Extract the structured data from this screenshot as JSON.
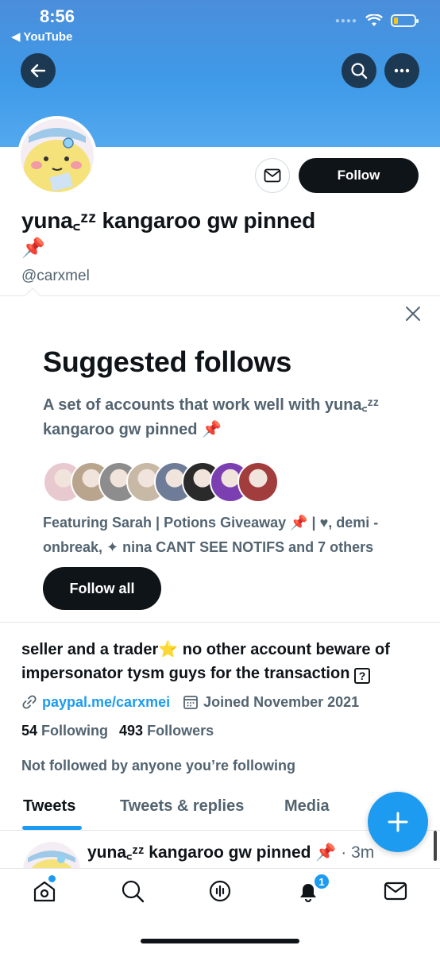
{
  "status_bar": {
    "time": "8:56",
    "back_app": "◀ YouTube"
  },
  "profile": {
    "display_name": "yuna꜀ᶻᶻ kangaroo gw pinned",
    "display_name_emoji": "📌",
    "handle": "@carxmel",
    "follow_label": "Follow",
    "bio": "seller and a trader⭐ no other account beware of impersonator tysm guys for the transaction",
    "bio_end_glyph": "?",
    "link": "paypal.me/carxmei",
    "joined": "Joined November 2021",
    "following_count": "54",
    "following_label": "Following",
    "followers_count": "493",
    "followers_label": "Followers",
    "not_followed": "Not followed by anyone you’re following"
  },
  "suggested": {
    "title": "Suggested follows",
    "description": "A set of accounts that work well with yuna꜀ᶻᶻ kangaroo gw pinned 📌",
    "featuring": "Featuring Sarah | Potions Giveaway 📌 | ♥, demi - onbreak, ✦ nina CANT SEE NOTIFS and 7 others",
    "follow_all_label": "Follow all",
    "face_colors": [
      "#e8c9cf",
      "#b9a48e",
      "#8d8d8d",
      "#c8b9a6",
      "#6f7c98",
      "#2a2a2a",
      "#7b3fb2",
      "#a23d3d"
    ]
  },
  "tabs": [
    "Tweets",
    "Tweets & replies",
    "Media"
  ],
  "tweet": {
    "name": "yuna꜀ᶻᶻ kangaroo gw pinned 📌",
    "time": "· 3m"
  },
  "nav": {
    "notification_count": "1"
  },
  "colors": {
    "accent": "#1d9bf0",
    "header": "#4a8edb",
    "text": "#0f1419",
    "muted": "#536471"
  }
}
